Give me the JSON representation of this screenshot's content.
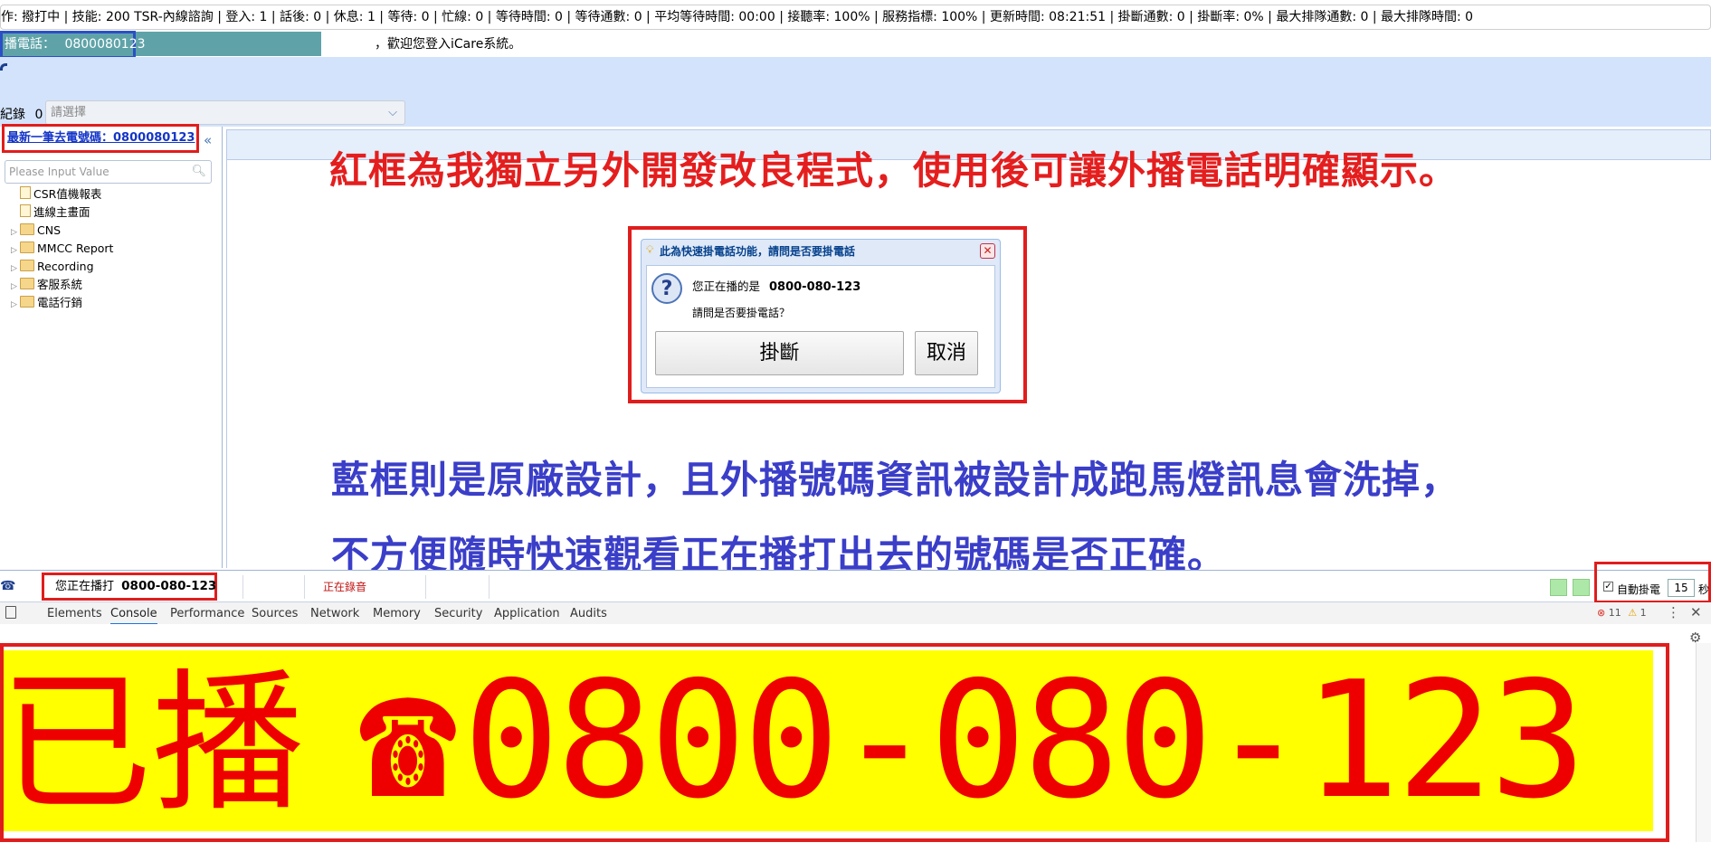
{
  "status_line": "作: 撥打中 | 技能: 200 TSR-內線諮詢 | 登入: 1 | 話後: 0 | 休息: 1 | 等待: 0 | 忙線: 0 | 等待時間: 0 | 等待通數: 0 | 平均等待時間: 00:00 | 接聽率: 100% | 服務指標: 100% | 更新時間: 08:21:51 | 掛斷通數: 0 | 掛斷率: 0% | 最大排隊通數: 0 | 最大排隊時間: 0",
  "header": {
    "phone_label": "播電話：",
    "phone_number": "0800080123",
    "welcome": "，歡迎您登入iCare系統。"
  },
  "record_bar": {
    "label": "紀錄",
    "count": "0",
    "select_placeholder": "請選擇"
  },
  "left_panel": {
    "last_dialed_label": "最新一筆去電號碼：",
    "last_dialed_number": "0800080123",
    "search_placeholder": "Please Input Value",
    "tree": [
      {
        "label": "CSR值機報表",
        "type": "doc"
      },
      {
        "label": "進線主畫面",
        "type": "doc"
      },
      {
        "label": "CNS",
        "type": "folder"
      },
      {
        "label": "MMCC Report",
        "type": "folder"
      },
      {
        "label": "Recording",
        "type": "folder"
      },
      {
        "label": "客服系統",
        "type": "folder"
      },
      {
        "label": "電話行銷",
        "type": "folder"
      }
    ]
  },
  "annotations": {
    "red_note": "紅框為我獨立另外開發改良程式，使用後可讓外播電話明確顯示。",
    "blue_note_line1": "藍框則是原廠設計，且外播號碼資訊被設計成跑馬燈訊息會洗掉，",
    "blue_note_line2": "不方便隨時快速觀看正在播打出去的號碼是否正確。"
  },
  "dialog": {
    "title": "此為快速掛電話功能，請問是否要掛電話",
    "message_prefix": "您正在播的是",
    "message_number": "0800-080-123",
    "question": "請問是否要掛電話？",
    "hangup_button": "掛斷",
    "cancel_button": "取消"
  },
  "call_strip": {
    "dialing_prefix": "您正在播打",
    "dialing_number": "0800-080-123",
    "recording": "正在錄音",
    "auto_hangup_label": "自動掛電",
    "auto_hangup_seconds": "15",
    "seconds_unit": "秒"
  },
  "devtools": {
    "tabs": [
      "Elements",
      "Console",
      "Performance",
      "Sources",
      "Network",
      "Memory",
      "Security",
      "Application",
      "Audits"
    ],
    "active_tab": "Console",
    "errors": "11",
    "warnings": "1"
  },
  "banner": {
    "prefix": "已播",
    "phone_icon": "☎",
    "number": "0800-080-123"
  },
  "colors": {
    "red_frame": "#e01d1d",
    "blue_frame": "#2b4fc6",
    "banner_bg": "#ffff00",
    "banner_text": "#ee0000"
  }
}
